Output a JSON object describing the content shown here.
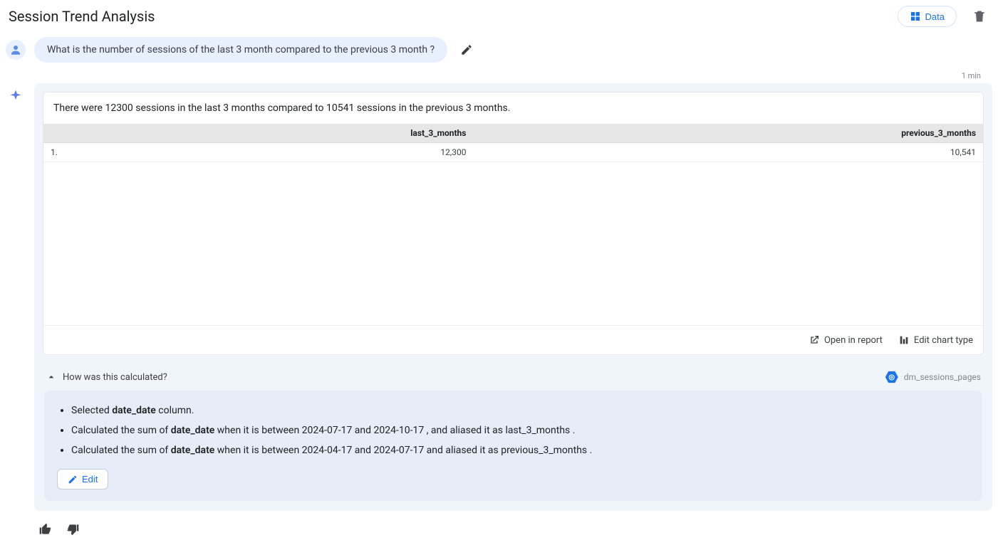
{
  "header": {
    "title": "Session Trend Analysis",
    "data_button_label": "Data"
  },
  "prompt": {
    "text": "What is the number of sessions of the last 3 month compared to the previous 3 month ?"
  },
  "timestamp": "1 min",
  "answer": {
    "summary": "There were 12300 sessions in the last 3 months compared to 10541 sessions in the previous 3 months.",
    "table": {
      "columns": [
        "last_3_months",
        "previous_3_months"
      ],
      "rows": [
        {
          "index": "1.",
          "last_3_months": "12,300",
          "previous_3_months": "10,541"
        }
      ]
    },
    "actions": {
      "open_in_report": "Open in report",
      "edit_chart_type": "Edit chart type"
    }
  },
  "explain": {
    "toggle_label": "How was this calculated?",
    "source_name": "dm_sessions_pages",
    "step1": {
      "pre": "Selected ",
      "bold": "date_date",
      "post": " column."
    },
    "step2": {
      "pre": "Calculated the sum of ",
      "bold": "date_date",
      "post": " when it is between 2024-07-17 and 2024-10-17 , and aliased it as last_3_months ."
    },
    "step3": {
      "pre": "Calculated the sum of ",
      "bold": "date_date",
      "post": " when it is between 2024-04-17 and 2024-07-17 and aliased it as previous_3_months ."
    },
    "edit_label": "Edit"
  },
  "chart_data": {
    "type": "table",
    "columns": [
      "last_3_months",
      "previous_3_months"
    ],
    "rows": [
      [
        12300,
        10541
      ]
    ]
  }
}
